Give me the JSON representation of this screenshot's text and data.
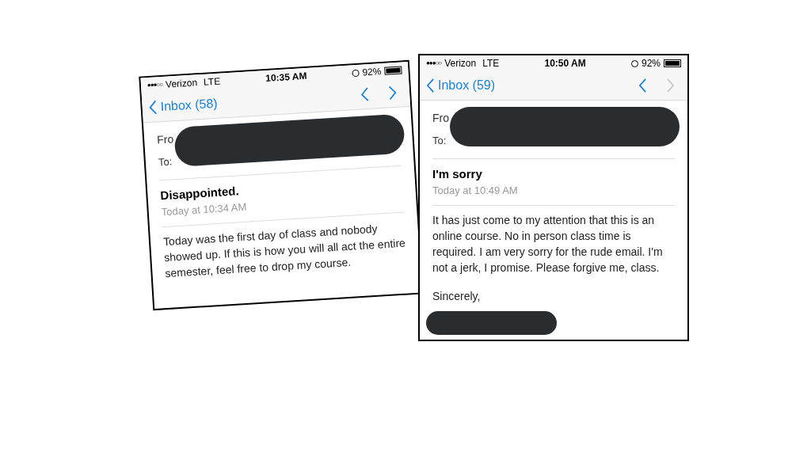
{
  "screens": [
    {
      "status_bar": {
        "signal": "●●●○○",
        "carrier": "Verizon",
        "network": "LTE",
        "time": "10:35 AM",
        "battery": "92%"
      },
      "nav": {
        "back": "Inbox (58)",
        "previous_disabled": false,
        "next_disabled": false
      },
      "header": {
        "from_label": "Fro",
        "to_label": "To:"
      },
      "subject": "Disappointed.",
      "date": "Today at 10:34 AM",
      "body": "Today was the first day of class and nobody showed up. If this is how you will all act the entire semester, feel free to drop my course."
    },
    {
      "status_bar": {
        "signal": "●●●○○",
        "carrier": "Verizon",
        "network": "LTE",
        "time": "10:50 AM",
        "battery": "92%"
      },
      "nav": {
        "back": "Inbox (59)",
        "previous_disabled": false,
        "next_disabled": true
      },
      "header": {
        "from_label": "Fro",
        "to_label": "To:"
      },
      "subject": "I'm sorry",
      "date": "Today at 10:49 AM",
      "body": "It has just come to my attention that this is an online course. No in person class time is required. I am very sorry for the rude email. I'm not a jerk, I promise. Please forgive me, class.",
      "signoff": "Sincerely,"
    }
  ]
}
